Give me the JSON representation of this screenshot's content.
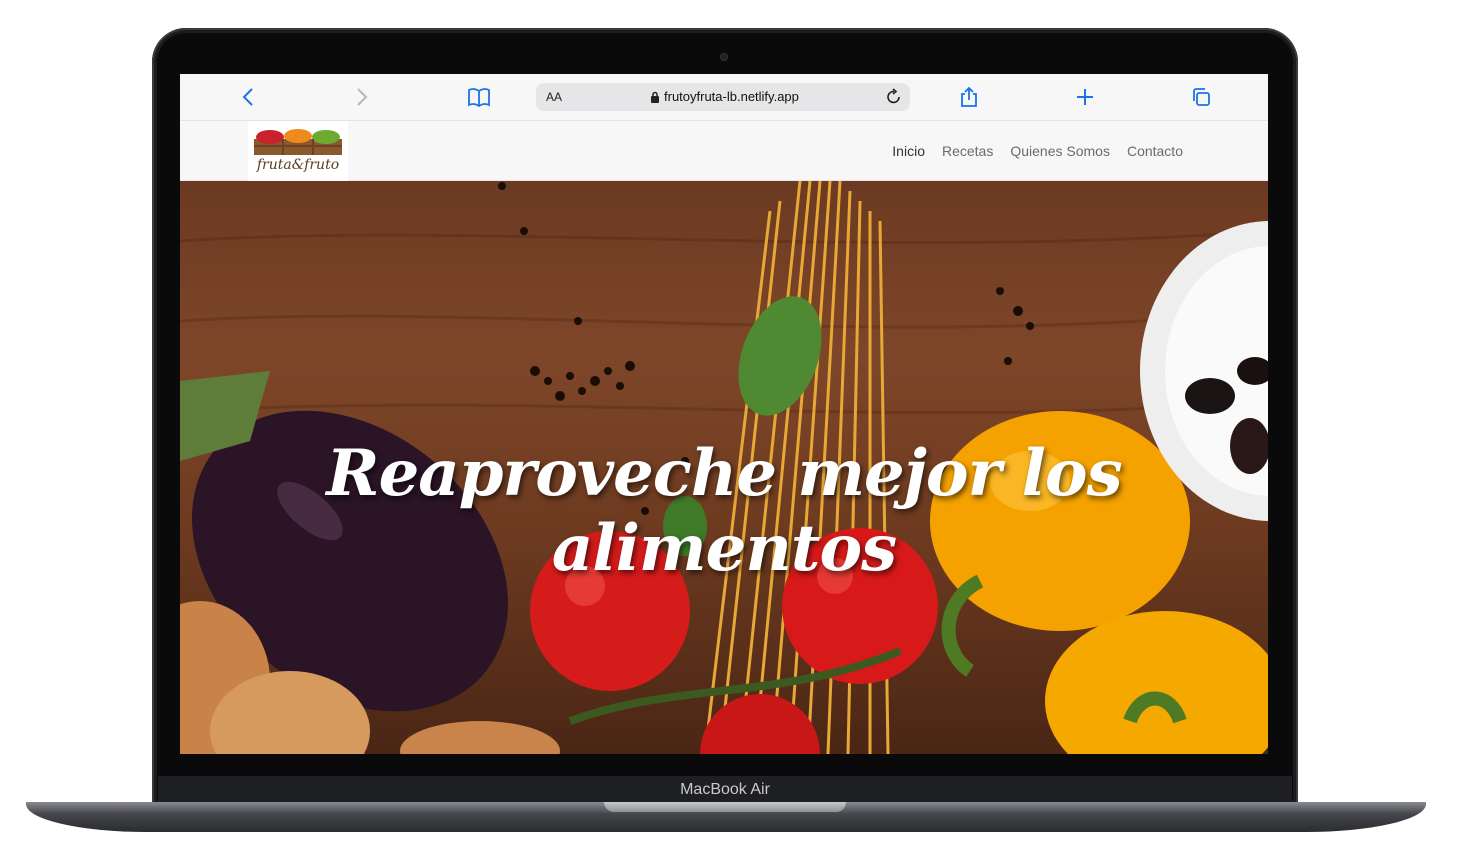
{
  "device": {
    "label": "MacBook Air"
  },
  "browser": {
    "url": "frutoyfruta-lb.netlify.app",
    "text_size_label": "AA"
  },
  "site": {
    "logo_text": "fruta&fruto",
    "nav": [
      {
        "label": "Inicio"
      },
      {
        "label": "Recetas"
      },
      {
        "label": "Quienes Somos"
      },
      {
        "label": "Contacto"
      }
    ],
    "hero_title": "Reaproveche mejor los alimentos"
  },
  "colors": {
    "accent": "#1a73e8"
  },
  "icons": [
    "back-icon",
    "forward-icon",
    "bookmarks-icon",
    "lock-icon",
    "reload-icon",
    "share-icon",
    "plus-icon",
    "tabs-icon"
  ]
}
